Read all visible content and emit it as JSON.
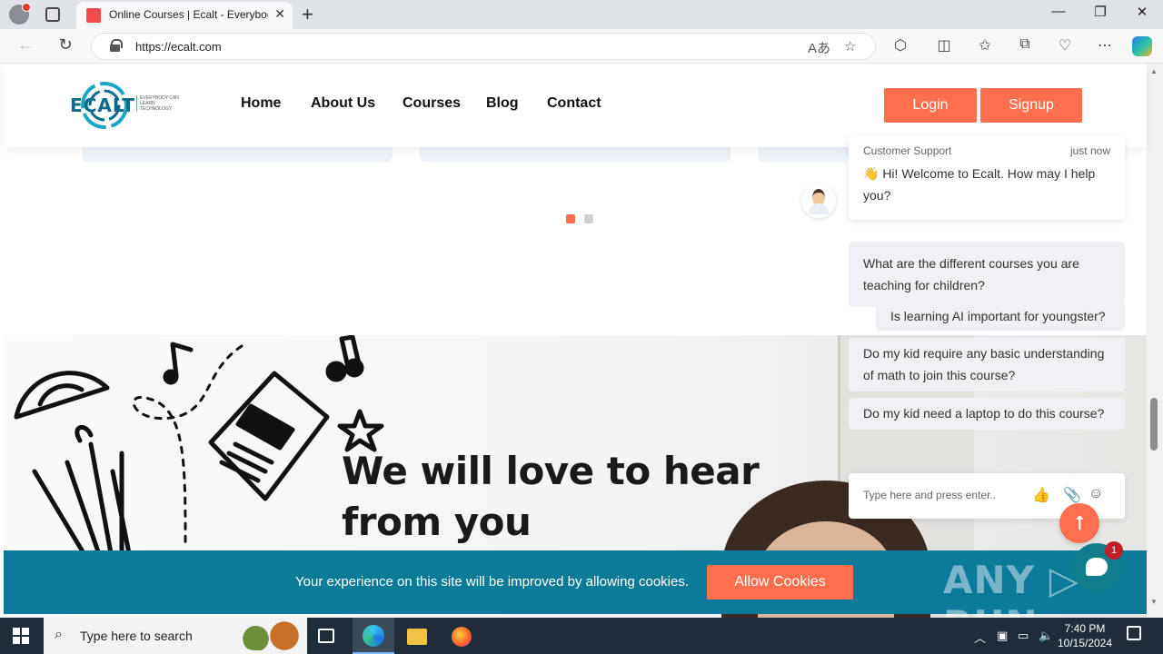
{
  "browser": {
    "tab_title": "Online Courses | Ecalt - Everybody Can Learn Technology",
    "tab_close": "✕",
    "new_tab": "+",
    "url": "https://ecalt.com",
    "window_controls": [
      "—",
      "❐",
      "✕"
    ]
  },
  "site": {
    "logo_text": "ECALT",
    "logo_tagline": "EVERYBODY CAN LEARN TECHNOLOGY",
    "nav": [
      "Home",
      "About Us",
      "Courses",
      "Blog",
      "Contact"
    ],
    "login_label": "Login",
    "signup_label": "Signup",
    "hero_title": "We will love to hear from you"
  },
  "chat": {
    "sender": "Customer Support",
    "time": "just now",
    "greeting": "👋 Hi! Welcome to Ecalt. How may I help you?",
    "options": [
      "What are the different courses you are teaching for children?",
      "Is learning AI important for youngster?",
      "Do my kid require any basic understanding of math to join this course?",
      "Do my kid need a laptop to do this course?"
    ],
    "input_placeholder": "Type here and press enter..",
    "badge_count": "1",
    "scroll_top_icon": "⭡"
  },
  "cookie": {
    "message": "Your experience on this site will be improved by allowing cookies.",
    "button_label": "Allow Cookies"
  },
  "watermark": "ANY ▷ RUN",
  "taskbar": {
    "search_placeholder": "Type here to search",
    "time": "7:40 PM",
    "date": "10/15/2024"
  },
  "colors": {
    "accent": "#ff6f4d",
    "cookie_bar": "#0b7b99",
    "logo": "#0c6b8a"
  }
}
